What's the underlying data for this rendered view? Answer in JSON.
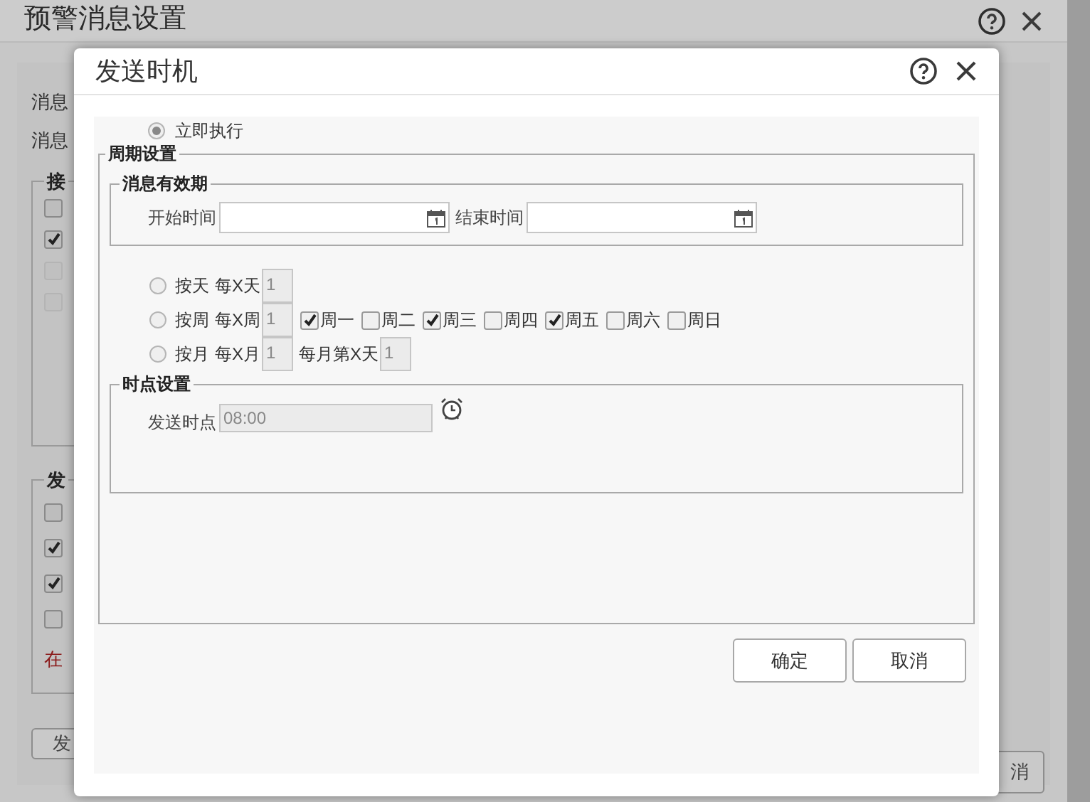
{
  "background_window": {
    "title": "预警消息设置",
    "labels": [
      "消息",
      "消息"
    ],
    "groups": [
      {
        "legend": "接",
        "checkboxes": [
          {
            "checked": false,
            "disabled": false
          },
          {
            "checked": true,
            "disabled": false
          },
          {
            "checked": false,
            "disabled": true
          },
          {
            "checked": false,
            "disabled": true
          }
        ]
      },
      {
        "legend": "发",
        "checkboxes": [
          {
            "checked": false,
            "disabled": false
          },
          {
            "checked": true,
            "disabled": false
          },
          {
            "checked": true,
            "disabled": false
          },
          {
            "checked": false,
            "disabled": false
          }
        ],
        "note": "在"
      }
    ],
    "buttons": [
      "发",
      "消"
    ]
  },
  "dialog": {
    "title": "发送时机",
    "immediate": {
      "label": "立即执行",
      "selected": true
    },
    "cycle": {
      "legend": "周期设置",
      "validity": {
        "legend": "消息有效期",
        "fields": [
          {
            "label": "开始时间"
          },
          {
            "label": "结束时间"
          }
        ]
      },
      "modes": [
        {
          "label": "按天",
          "selected": false,
          "fields": [
            {
              "label": "每X天",
              "value": "1"
            }
          ]
        },
        {
          "label": "按周",
          "selected": false,
          "fields": [
            {
              "label": "每X周",
              "value": "1"
            }
          ],
          "days": [
            {
              "label": "周一",
              "checked": true
            },
            {
              "label": "周二",
              "checked": false
            },
            {
              "label": "周三",
              "checked": true
            },
            {
              "label": "周四",
              "checked": false
            },
            {
              "label": "周五",
              "checked": true
            },
            {
              "label": "周六",
              "checked": false
            },
            {
              "label": "周日",
              "checked": false
            }
          ]
        },
        {
          "label": "按月",
          "selected": false,
          "fields": [
            {
              "label": "每X月",
              "value": "1"
            },
            {
              "label": "每月第X天",
              "value": "1"
            }
          ]
        }
      ],
      "time": {
        "legend": "时点设置",
        "label": "发送时点",
        "value": "08:00"
      }
    },
    "buttons": [
      {
        "label": "确定"
      },
      {
        "label": "取消"
      }
    ]
  }
}
